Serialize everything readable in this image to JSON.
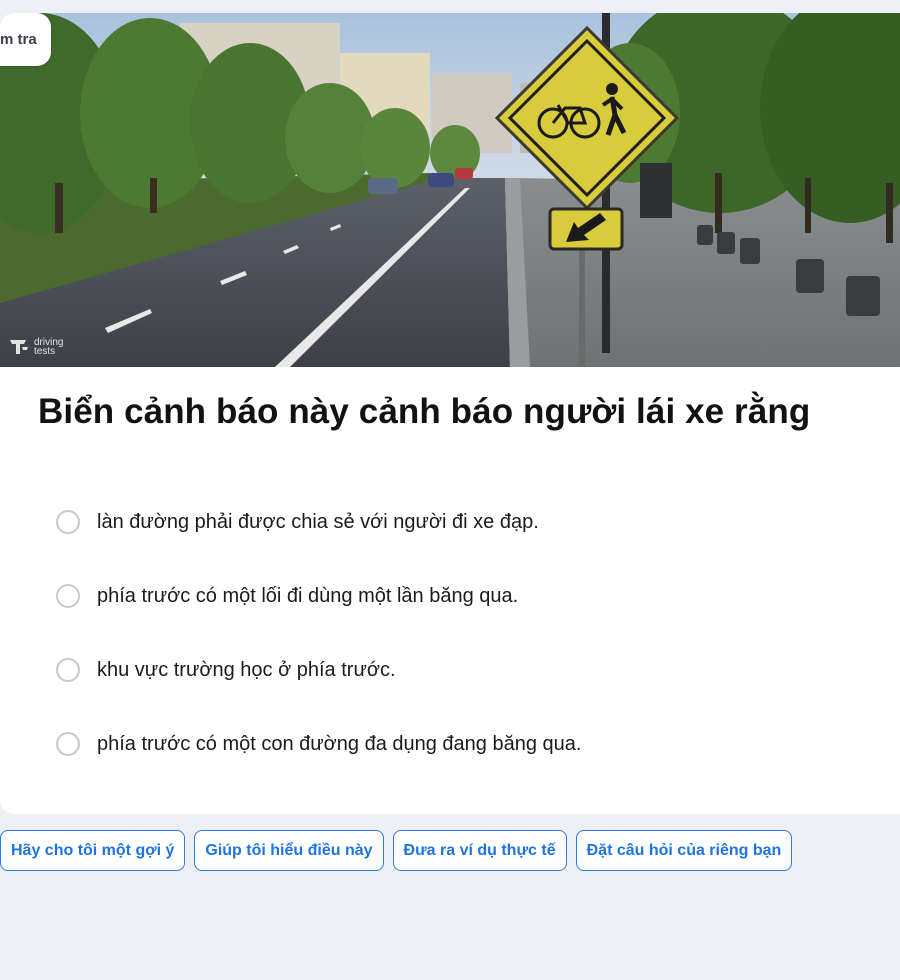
{
  "hero": {
    "chip_label": "m tra",
    "watermark_text": "driving tests",
    "image_description_icon": "road-sign-photo"
  },
  "question": {
    "text": "Biển cảnh báo này cảnh báo người lái xe rằng"
  },
  "options": [
    {
      "label": "làn đường phải được chia sẻ với người đi xe đạp."
    },
    {
      "label": "phía trước có một lối đi dùng một lần băng qua."
    },
    {
      "label": "khu vực trường học ở phía trước."
    },
    {
      "label": "phía trước có một con đường đa dụng đang băng qua."
    }
  ],
  "actions": [
    {
      "label": "Hãy cho tôi một gợi ý"
    },
    {
      "label": "Giúp tôi hiểu điều này"
    },
    {
      "label": "Đưa ra ví dụ thực tế"
    },
    {
      "label": "Đặt câu hỏi của riêng bạn"
    }
  ],
  "colors": {
    "page_bg": "#eff0f6",
    "accent": "#1f74de",
    "sign_yellow": "#d4c73a"
  }
}
